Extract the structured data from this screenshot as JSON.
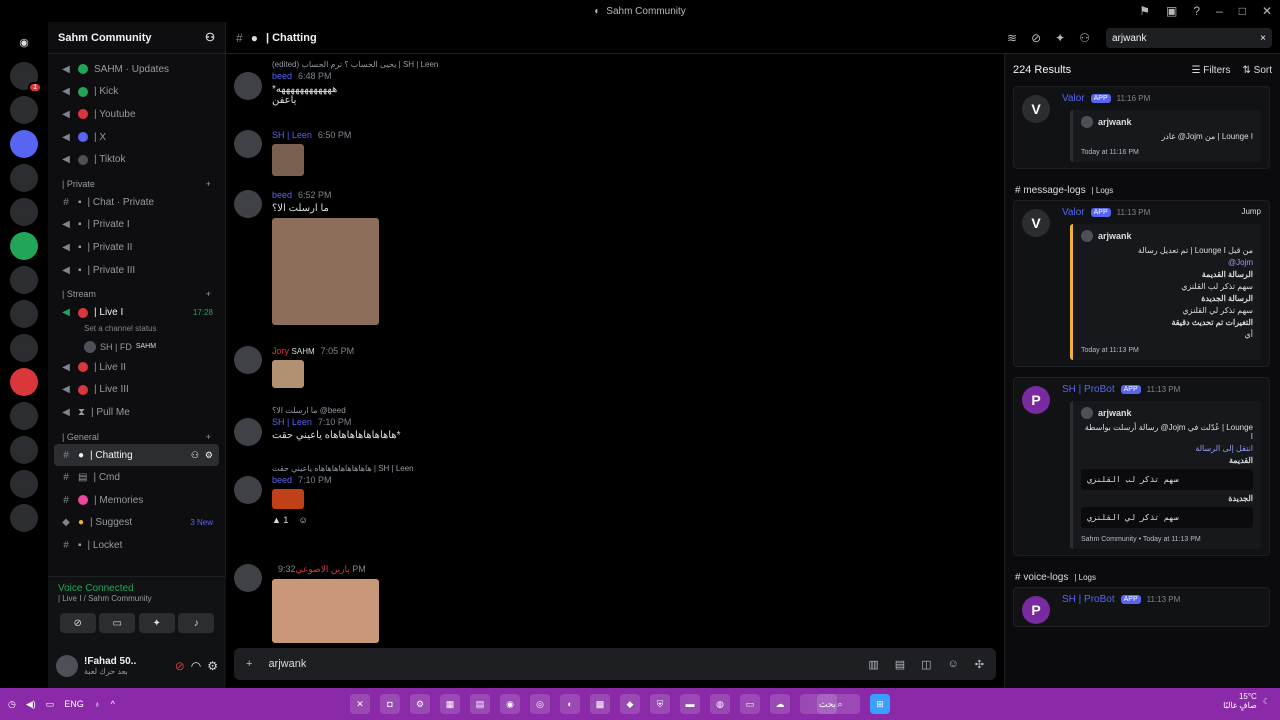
{
  "window": {
    "title": "Sahm Community"
  },
  "server": {
    "name": "Sahm Community"
  },
  "channels": [
    {
      "label": "SAHM · Updates",
      "dot": "#23a559",
      "sym": "◀"
    },
    {
      "label": "| Kick",
      "dot": "#23a559",
      "sym": "◀"
    },
    {
      "label": "| Youtube",
      "dot": "#da373c",
      "sym": "◀"
    },
    {
      "label": "| X",
      "dot": "#5865f2",
      "sym": "◀"
    },
    {
      "label": "| Tiktok",
      "dot": "#4e5058",
      "sym": "◀"
    }
  ],
  "cat_private": "| Private",
  "private_channels": [
    "| Chat · Private",
    "| Private I",
    "| Private II",
    "| Private III"
  ],
  "cat_stream": "| Stream",
  "live_channel": {
    "label": "| Live I",
    "time": "17:28"
  },
  "channel_status": "Set a channel status",
  "live_user": "SH | FD",
  "live_user_tag": "SAHM",
  "stream_channels": [
    "| Live II",
    "| Live III",
    "| Pull Me"
  ],
  "cat_general": "| General",
  "general_channels": [
    {
      "label": "| Chatting",
      "active": true
    },
    {
      "label": "| Cmd"
    },
    {
      "label": "| Memories"
    },
    {
      "label": "| Suggest",
      "badge": "3 New"
    },
    {
      "label": "| Locket"
    }
  ],
  "voice": {
    "status": "Voice Connected",
    "where": "| Live I / Sahm Community"
  },
  "me": {
    "name": "!Fahad 50..",
    "sub": "بعد حرك لعبة"
  },
  "topbar": {
    "channel": "| Chatting"
  },
  "search": {
    "value": "arjwank",
    "close": "×"
  },
  "messages": [
    {
      "reply": "(edited) يحيى الحساب ؟ ترم الحساب | SH | Leen",
      "author": "beed",
      "time": "6:48 PM",
      "text": "*ههههههههههههه\nياعفن"
    },
    {
      "author": "SH | Leen",
      "time": "6:50 PM",
      "text": ""
    },
    {
      "author": "beed",
      "time": "6:52 PM",
      "text": "ما ارسلت الا؟"
    },
    {
      "author": "Jory",
      "tag": "SAHM",
      "time": "7:05 PM",
      "text": ""
    },
    {
      "reply": "ما ارسلت الا؟ @beed",
      "author": "SH | Leen",
      "time": "7:10 PM",
      "text": "هاهاهاهاهاهاهاهاه ياعيني حقت*"
    },
    {
      "reply": "هاهاهاهاهاهاهاهاه ياعيني حقت | SH | Leen",
      "author": "beed",
      "time": "7:10 PM",
      "text": "",
      "reaction": "1"
    },
    {
      "author": "بارين الاصوعي",
      "time": "9:32 PM",
      "text": ""
    }
  ],
  "composer": {
    "value": "arjwank"
  },
  "results": {
    "count": "224 Results",
    "filters": "Filters",
    "sort": "Sort",
    "loc1": "# message-logs",
    "loc1_sub": "| Logs",
    "loc2": "# voice-logs",
    "loc2_sub": "| Logs",
    "r1": {
      "bot": "Valor",
      "app": "APP",
      "time": "11:16 PM",
      "user": "arjwank",
      "line1": "غادر @Jojm من | Lounge I",
      "footer": "Today at 11:16 PM"
    },
    "r2": {
      "bot": "Valor",
      "app": "APP",
      "time": "11:13 PM",
      "jump": "Jump",
      "user": "arjwank",
      "line1": "تم تعديل رسالة | Lounge I من قبل",
      "mention": "@Jojm",
      "old_label": "الرسالة القديمة",
      "old_text": "سهم تذكر لب القلنزي",
      "new_label": "الرسالة الجديدة",
      "new_text": "سهم تذكر لي القلنزي",
      "extra": "التغيرات تم تحديث دقيقة",
      "extra2": "أي",
      "footer": "Today at 11:13 PM"
    },
    "r3": {
      "bot": "SH | ProBot",
      "app": "APP",
      "time": "11:13 PM",
      "user": "arjwank",
      "line1": "رسالة أرسلت بواسطة @Jojm عُدّلت في | Lounge I",
      "line2": "انتقل إلى الرسالة",
      "old_label": "القديمة",
      "old_text": "سهم تذكر لب القلنزي",
      "new_label": "الجديدة",
      "new_text": "سهم تذكر لي القلنزي",
      "footer": "Sahm Community • Today at 11:13 PM"
    },
    "r4": {
      "bot": "SH | ProBot",
      "app": "APP",
      "time": "11:13 PM"
    }
  },
  "taskbar": {
    "lang": "ENG",
    "search": "بحث",
    "temp": "15°C",
    "weather": "صافٍ غالبًا"
  }
}
